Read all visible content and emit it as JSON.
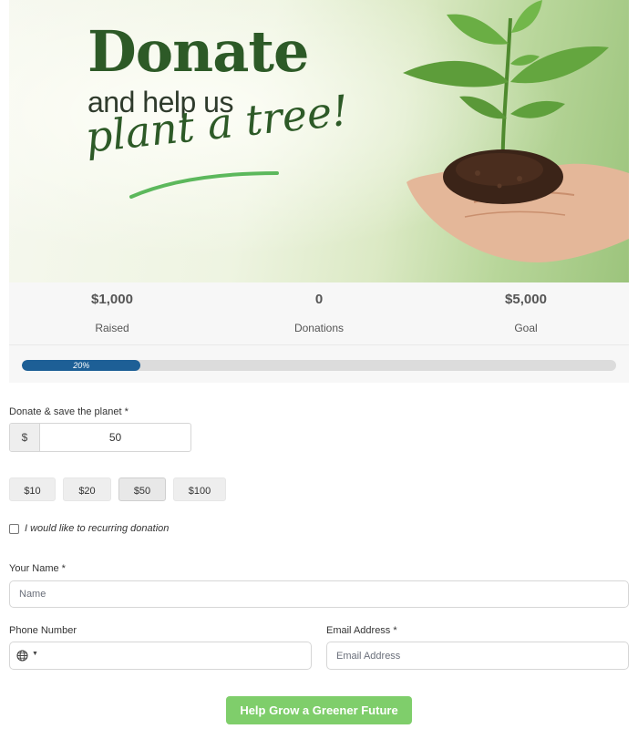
{
  "hero": {
    "title": "Donate",
    "subtitle": "and help us",
    "script_text": "plant a tree!"
  },
  "stats": [
    {
      "value": "$1,000",
      "label": "Raised"
    },
    {
      "value": "0",
      "label": "Donations"
    },
    {
      "value": "$5,000",
      "label": "Goal"
    }
  ],
  "progress": {
    "percent": 20,
    "label": "20%"
  },
  "amount": {
    "label": "Donate & save the planet *",
    "currency_symbol": "$",
    "value": "50",
    "presets": [
      "$10",
      "$20",
      "$50",
      "$100"
    ],
    "selected_preset": "$50"
  },
  "recurring": {
    "label": "I would like to recurring donation",
    "checked": false
  },
  "form": {
    "name_label": "Your Name *",
    "name_placeholder": "Name",
    "phone_label": "Phone Number",
    "email_label": "Email Address *",
    "email_placeholder": "Email Address"
  },
  "submit_label": "Help Grow a Greener Future",
  "colors": {
    "brand_green": "#2d5a27",
    "progress_blue": "#1d5f96",
    "button_green": "#7fce6b"
  }
}
